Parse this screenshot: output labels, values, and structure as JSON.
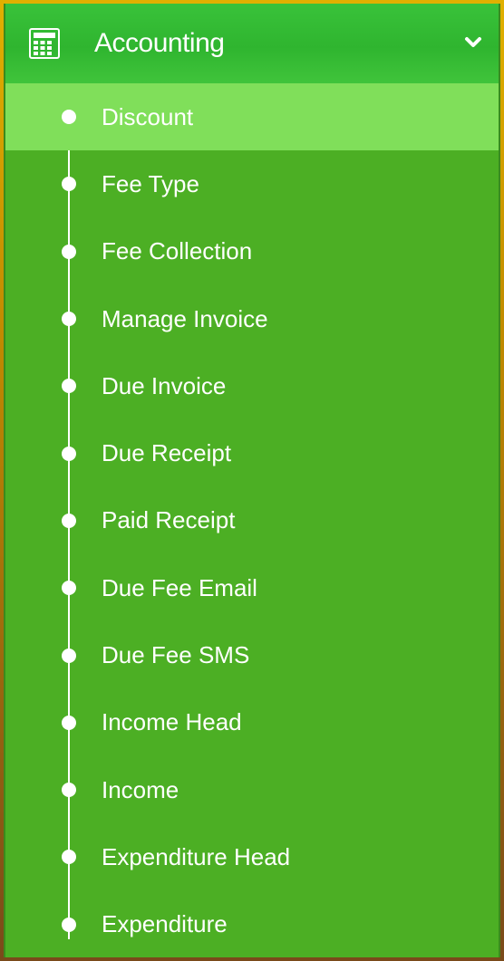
{
  "menu": {
    "title": "Accounting",
    "icon": "calculator-icon",
    "expand_icon": "chevron-down-icon",
    "colors": {
      "panel": "#4caf24",
      "header": "#34bb35",
      "active_item": "#80df5a",
      "text": "#ffffff"
    },
    "items": [
      {
        "label": "Discount",
        "active": true
      },
      {
        "label": "Fee Type"
      },
      {
        "label": "Fee Collection"
      },
      {
        "label": "Manage Invoice"
      },
      {
        "label": "Due Invoice"
      },
      {
        "label": "Due Receipt"
      },
      {
        "label": "Paid Receipt"
      },
      {
        "label": "Due Fee Email"
      },
      {
        "label": "Due Fee SMS"
      },
      {
        "label": "Income Head"
      },
      {
        "label": "Income"
      },
      {
        "label": "Expenditure Head"
      },
      {
        "label": "Expenditure"
      }
    ]
  }
}
